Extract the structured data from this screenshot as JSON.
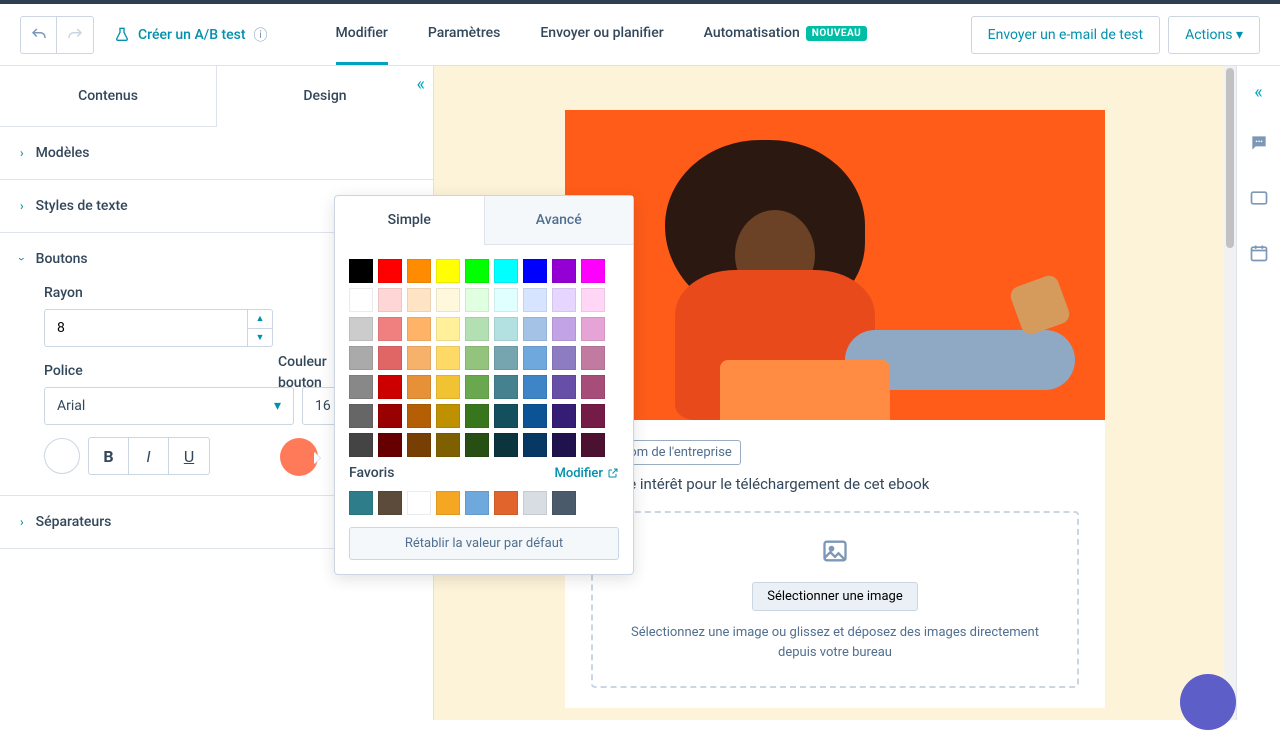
{
  "toolbar": {
    "ab_test": "Créer un A/B test",
    "tabs": [
      "Modifier",
      "Paramètres",
      "Envoyer ou planifier",
      "Automatisation"
    ],
    "active_tab": 0,
    "badge_new": "NOUVEAU",
    "send_test": "Envoyer un e-mail de test",
    "actions": "Actions"
  },
  "sidebar": {
    "tabs": [
      "Contenus",
      "Design"
    ],
    "active": 1,
    "sections": {
      "models": "Modèles",
      "text_styles": "Styles de texte",
      "buttons": "Boutons",
      "separators": "Séparateurs"
    },
    "buttons_panel": {
      "radius_label": "Rayon",
      "radius_value": "8",
      "color_label_1": "Couleur",
      "color_label_2": "bouton",
      "font_label": "Police",
      "font_value": "Arial",
      "font_size": "16"
    }
  },
  "color_picker": {
    "tab_simple": "Simple",
    "tab_advanced": "Avancé",
    "favorites_label": "Favoris",
    "modify_link": "Modifier",
    "reset": "Rétablir la valeur par défaut",
    "current": "#ff7a59",
    "palette": [
      "#000000",
      "#ff0000",
      "#ff8c00",
      "#ffff00",
      "#00ff00",
      "#00ffff",
      "#0000ff",
      "#9400d3",
      "#ff00ff",
      "#ffffff",
      "#ffd6d6",
      "#ffe4c4",
      "#fff8dc",
      "#e0ffe0",
      "#e0ffff",
      "#d6e4ff",
      "#e6d6ff",
      "#ffd6f5",
      "#cccccc",
      "#f08080",
      "#ffb366",
      "#fff099",
      "#b3e0b3",
      "#b3e0e0",
      "#a3c2e6",
      "#c2a3e6",
      "#e6a3d6",
      "#aaaaaa",
      "#e06666",
      "#f6b26b",
      "#ffd966",
      "#93c47d",
      "#76a5af",
      "#6fa8dc",
      "#8e7cc3",
      "#c27ba0",
      "#888888",
      "#cc0000",
      "#e69138",
      "#f1c232",
      "#6aa84f",
      "#45818e",
      "#3d85c6",
      "#674ea7",
      "#a64d79",
      "#666666",
      "#990000",
      "#b45f06",
      "#bf9000",
      "#38761d",
      "#134f5c",
      "#0b5394",
      "#351c75",
      "#741b47",
      "#444444",
      "#660000",
      "#783f04",
      "#7f6000",
      "#274e13",
      "#0c343d",
      "#073763",
      "#20124d",
      "#4c1130"
    ],
    "favorites": [
      "#2e7d8a",
      "#5c4a3a",
      "#ffffff",
      "#f5a623",
      "#6fa8dc",
      "#e0642b",
      "#d8dde3",
      "#4a5a6a"
    ]
  },
  "preview": {
    "company_chip": "Nom de l'entreprise",
    "body_text": "e votre intérêt pour le téléchargement de cet ebook",
    "select_image_btn": "Sélectionner une image",
    "dropzone_text": "Sélectionnez une image ou glissez et déposez des images directement depuis votre bureau"
  }
}
